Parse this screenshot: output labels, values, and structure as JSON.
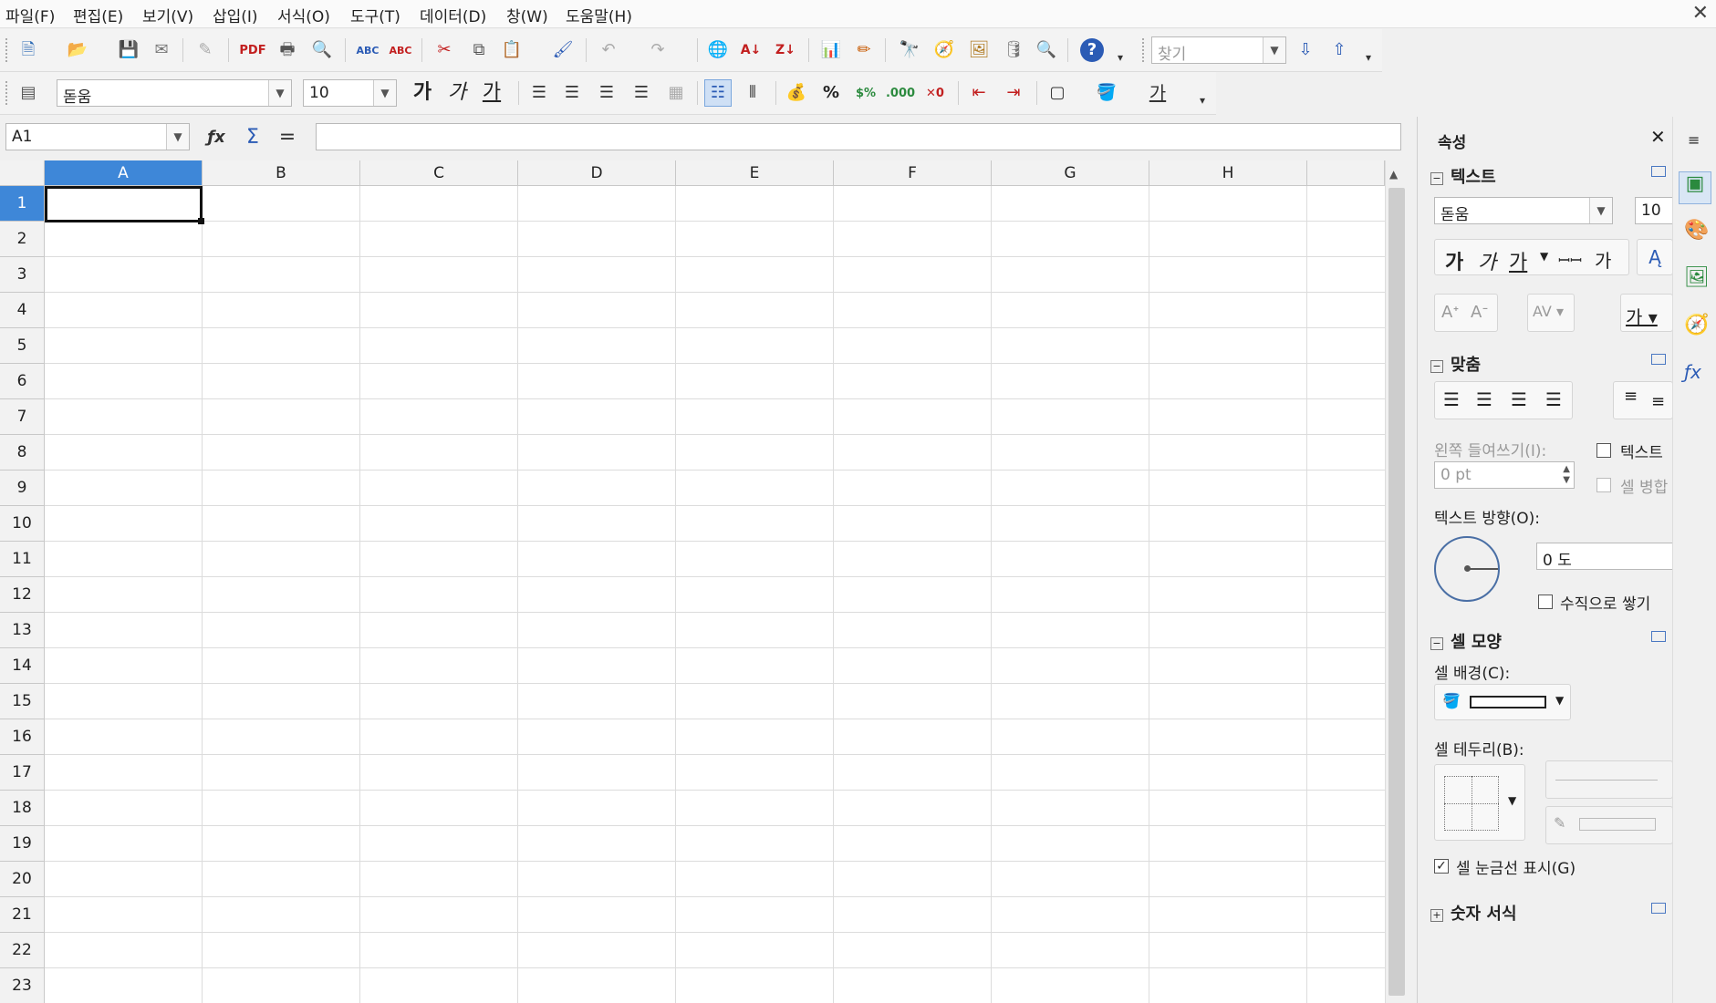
{
  "menu": [
    "파일(F)",
    "편집(E)",
    "보기(V)",
    "삽입(I)",
    "서식(O)",
    "도구(T)",
    "데이터(D)",
    "창(W)",
    "도움말(H)"
  ],
  "toolbar1": {
    "find_placeholder": "찾기"
  },
  "toolbar2": {
    "font_name": "돋움",
    "font_size": "10",
    "bold": "가",
    "italic": "가",
    "underline": "가",
    "percent": "%"
  },
  "formula_bar": {
    "name_box": "A1",
    "formula": ""
  },
  "grid": {
    "columns": [
      "A",
      "B",
      "C",
      "D",
      "E",
      "F",
      "G",
      "H"
    ],
    "rows": [
      "1",
      "2",
      "3",
      "4",
      "5",
      "6",
      "7",
      "8",
      "9",
      "10",
      "11",
      "12",
      "13",
      "14",
      "15",
      "16",
      "17",
      "18",
      "19",
      "20",
      "21",
      "22",
      "23"
    ],
    "selected_cell": "A1"
  },
  "sidebar": {
    "title": "속성",
    "text_section": {
      "title": "텍스트",
      "font_name": "돋움",
      "font_size": "10",
      "bold": "가",
      "italic": "가",
      "underline": "가",
      "spacing": "ꟷꟷ",
      "shadow": "가"
    },
    "align_section": {
      "title": "맞춤",
      "indent_label": "왼쪽 들여쓰기(I):",
      "indent_value": "0 pt",
      "wrap_label": "텍스트",
      "merge_label": "셀 병합",
      "direction_label": "텍스트 방향(O):",
      "angle_value": "0 도",
      "stack_label": "수직으로 쌓기"
    },
    "cell_section": {
      "title": "셀 모양",
      "bg_label": "셀 배경(C):",
      "border_label": "셀 테두리(B):",
      "gridlines_label": "셀 눈금선 표시(G)",
      "gridlines_checked": true
    },
    "number_section": {
      "title": "숫자 서식"
    }
  },
  "colors": {
    "accent": "#3e87d8",
    "grid_line": "#dcdcdc"
  }
}
